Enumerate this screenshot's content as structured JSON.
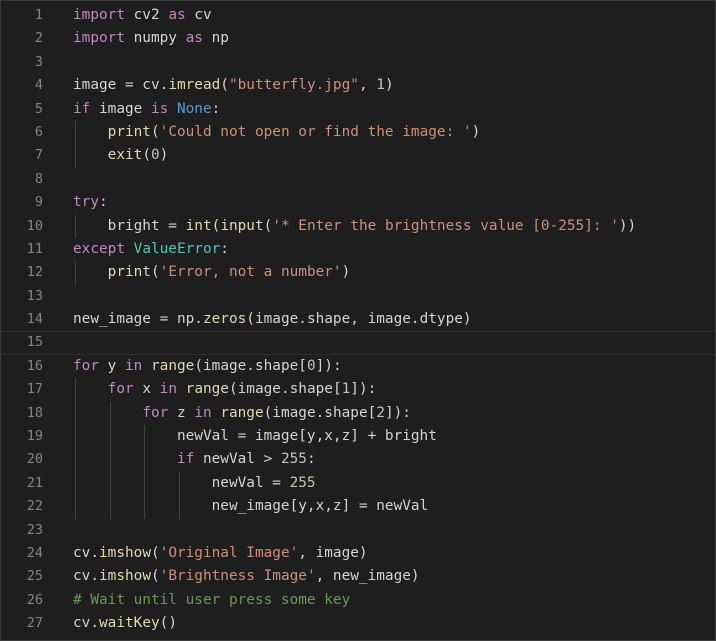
{
  "editor": {
    "language": "python",
    "theme_colors": {
      "background": "#1e1e1e",
      "line_number": "#858585",
      "keyword": "#c586c0",
      "builtin_keyword": "#569cd6",
      "function": "#dcdcaa",
      "string": "#ce9178",
      "number": "#b5cea8",
      "class": "#4ec9b0",
      "comment": "#6a9955",
      "text": "#d4d4d4"
    },
    "lines": [
      {
        "n": "1",
        "t": "import cv2 as cv"
      },
      {
        "n": "2",
        "t": "import numpy as np"
      },
      {
        "n": "3",
        "t": ""
      },
      {
        "n": "4",
        "t": "image = cv.imread(\"butterfly.jpg\", 1)"
      },
      {
        "n": "5",
        "t": "if image is None:"
      },
      {
        "n": "6",
        "t": "    print('Could not open or find the image: ')"
      },
      {
        "n": "7",
        "t": "    exit(0)"
      },
      {
        "n": "8",
        "t": ""
      },
      {
        "n": "9",
        "t": "try:"
      },
      {
        "n": "10",
        "t": "    bright = int(input('* Enter the brightness value [0-255]: '))"
      },
      {
        "n": "11",
        "t": "except ValueError:"
      },
      {
        "n": "12",
        "t": "    print('Error, not a number')"
      },
      {
        "n": "13",
        "t": ""
      },
      {
        "n": "14",
        "t": "new_image = np.zeros(image.shape, image.dtype)"
      },
      {
        "n": "15",
        "t": ""
      },
      {
        "n": "16",
        "t": "for y in range(image.shape[0]):"
      },
      {
        "n": "17",
        "t": "    for x in range(image.shape[1]):"
      },
      {
        "n": "18",
        "t": "        for z in range(image.shape[2]):"
      },
      {
        "n": "19",
        "t": "            newVal = image[y,x,z] + bright"
      },
      {
        "n": "20",
        "t": "            if newVal > 255:"
      },
      {
        "n": "21",
        "t": "                newVal = 255"
      },
      {
        "n": "22",
        "t": "                new_image[y,x,z] = newVal"
      },
      {
        "n": "23",
        "t": ""
      },
      {
        "n": "24",
        "t": "cv.imshow('Original Image', image)"
      },
      {
        "n": "25",
        "t": "cv.imshow('Brightness Image', new_image)"
      },
      {
        "n": "26",
        "t": "# Wait until user press some key"
      },
      {
        "n": "27",
        "t": "cv.waitKey()"
      }
    ],
    "active_line": "15"
  }
}
